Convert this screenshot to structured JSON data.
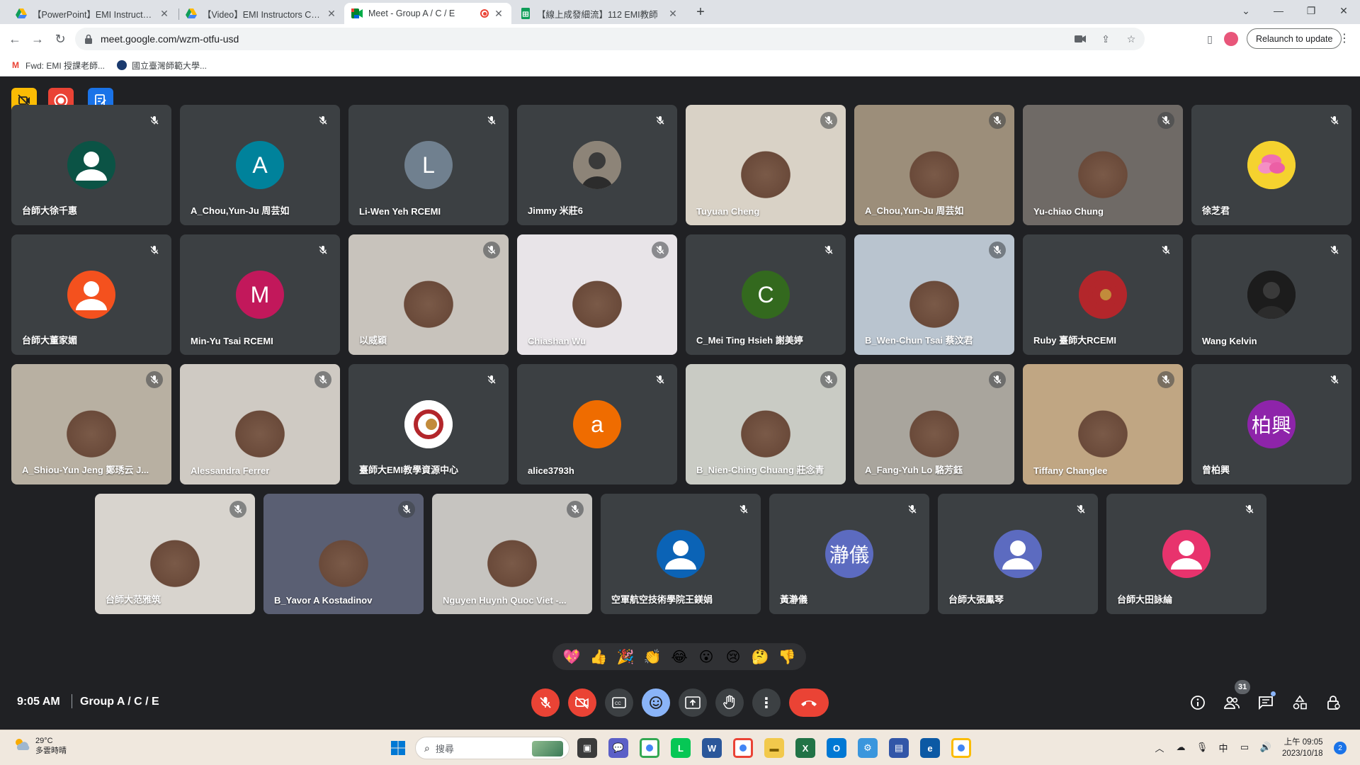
{
  "browser": {
    "tabs": [
      {
        "label": "【PowerPoint】EMI Instructors",
        "icon": "google-drive-icon",
        "active": false
      },
      {
        "label": "【Video】EMI Instructors Com",
        "icon": "google-drive-icon",
        "active": false
      },
      {
        "label": "Meet - Group A / C / E",
        "icon": "google-meet-icon",
        "active": true
      },
      {
        "label": "【線上成發細流】112 EMI教師",
        "icon": "google-sheets-icon",
        "active": false
      }
    ],
    "url": "meet.google.com/wzm-otfu-usd",
    "relaunch_label": "Relaunch to update",
    "bookmarks": [
      {
        "label": "Fwd: EMI 授課老師...",
        "icon": "gmail-icon"
      },
      {
        "label": "國立臺灣師範大學...",
        "icon": "ntnu-logo-icon"
      }
    ]
  },
  "meet": {
    "time": "9:05 AM",
    "meeting_name": "Group A / C / E",
    "participant_count": "31",
    "participants": [
      {
        "name": "台師大徐千惠",
        "type": "avatar",
        "avatar_color": "#0b5345",
        "avatar_kind": "person"
      },
      {
        "name": "A_Chou,Yun-Ju 周芸如",
        "type": "avatar",
        "avatar_color": "#00829b",
        "initial": "A"
      },
      {
        "name": "Li-Wen Yeh RCEMI",
        "type": "avatar",
        "avatar_color": "#70808f",
        "initial": "L"
      },
      {
        "name": "Jimmy 米莊6",
        "type": "avatar",
        "avatar_color": "#8d8478",
        "avatar_kind": "photo"
      },
      {
        "name": "Tuyuan Cheng",
        "type": "video",
        "bg": "#d9d2c6"
      },
      {
        "name": "A_Chou,Yun-Ju 周芸如",
        "type": "video",
        "bg": "#9c8e7a"
      },
      {
        "name": "Yu-chiao Chung",
        "type": "video",
        "bg": "#6f6a66"
      },
      {
        "name": "徐芝君",
        "type": "avatar",
        "avatar_color": "#f5d22f",
        "avatar_kind": "flower"
      },
      {
        "name": "台師大董家媚",
        "type": "avatar",
        "avatar_color": "#f4511e",
        "avatar_kind": "person"
      },
      {
        "name": "Min-Yu Tsai RCEMI",
        "type": "avatar",
        "avatar_color": "#c2185b",
        "initial": "M"
      },
      {
        "name": "以威穎",
        "type": "video",
        "bg": "#c8c3bc"
      },
      {
        "name": "Chiashan Wu",
        "type": "video",
        "bg": "#e8e4e8"
      },
      {
        "name": "C_Mei Ting Hsieh 謝美婷",
        "type": "avatar",
        "avatar_color": "#33691e",
        "initial": "C"
      },
      {
        "name": "B_Wen-Chun Tsai 蔡汶君",
        "type": "video",
        "bg": "#b9c4cf"
      },
      {
        "name": "Ruby 臺師大RCEMI",
        "type": "avatar",
        "avatar_color": "#b3262b",
        "avatar_kind": "logo"
      },
      {
        "name": "Wang Kelvin",
        "type": "avatar",
        "avatar_color": "#1c1c1c",
        "avatar_kind": "photo"
      },
      {
        "name": "A_Shiou-Yun Jeng 鄭琇云 J...",
        "type": "video",
        "bg": "#b8b0a2"
      },
      {
        "name": "Alessandra Ferrer",
        "type": "video",
        "bg": "#cfcac3"
      },
      {
        "name": "臺師大EMI教學資源中心",
        "type": "avatar",
        "avatar_color": "#ffffff",
        "avatar_kind": "logo"
      },
      {
        "name": "alice3793h",
        "type": "avatar",
        "avatar_color": "#ef6c00",
        "initial": "a"
      },
      {
        "name": "B_Nien-Ching Chuang 莊念青",
        "type": "video",
        "bg": "#c9cbc4"
      },
      {
        "name": "A_Fang-Yuh Lo 駱芳鈺",
        "type": "video",
        "bg": "#a9a59d"
      },
      {
        "name": "Tiffany Changlee",
        "type": "video",
        "bg": "#c0a683"
      },
      {
        "name": "曾柏興",
        "type": "avatar",
        "avatar_color": "#8e24aa",
        "initial": "柏興"
      },
      {
        "name": "台師大范雅筑",
        "type": "video",
        "bg": "#d8d4ce"
      },
      {
        "name": "B_Yavor A Kostadinov",
        "type": "video",
        "bg": "#5a5f73"
      },
      {
        "name": "Nguyen Huynh Quoc Viet -...",
        "type": "video",
        "bg": "#c6c4c0"
      },
      {
        "name": "空軍航空技術學院王鎂娟",
        "type": "avatar",
        "avatar_color": "#0b63b6",
        "avatar_kind": "person"
      },
      {
        "name": "黃瀞儀",
        "type": "avatar",
        "avatar_color": "#5c6bc0",
        "initial": "瀞儀"
      },
      {
        "name": "台師大張鳳琴",
        "type": "avatar",
        "avatar_color": "#5c6bc0",
        "avatar_kind": "person"
      },
      {
        "name": "台師大田詠綸",
        "type": "avatar",
        "avatar_color": "#e8336d",
        "avatar_kind": "person"
      }
    ],
    "reactions": [
      "💖",
      "👍",
      "🎉",
      "👏",
      "😂",
      "😮",
      "😢",
      "🤔",
      "👎"
    ]
  },
  "taskbar": {
    "weather_temp": "29°C",
    "weather_desc": "多雲時晴",
    "search_placeholder": "搜尋",
    "ime": "中",
    "time_line1": "上午 09:05",
    "time_line2": "2023/10/18",
    "notifications": "2"
  }
}
